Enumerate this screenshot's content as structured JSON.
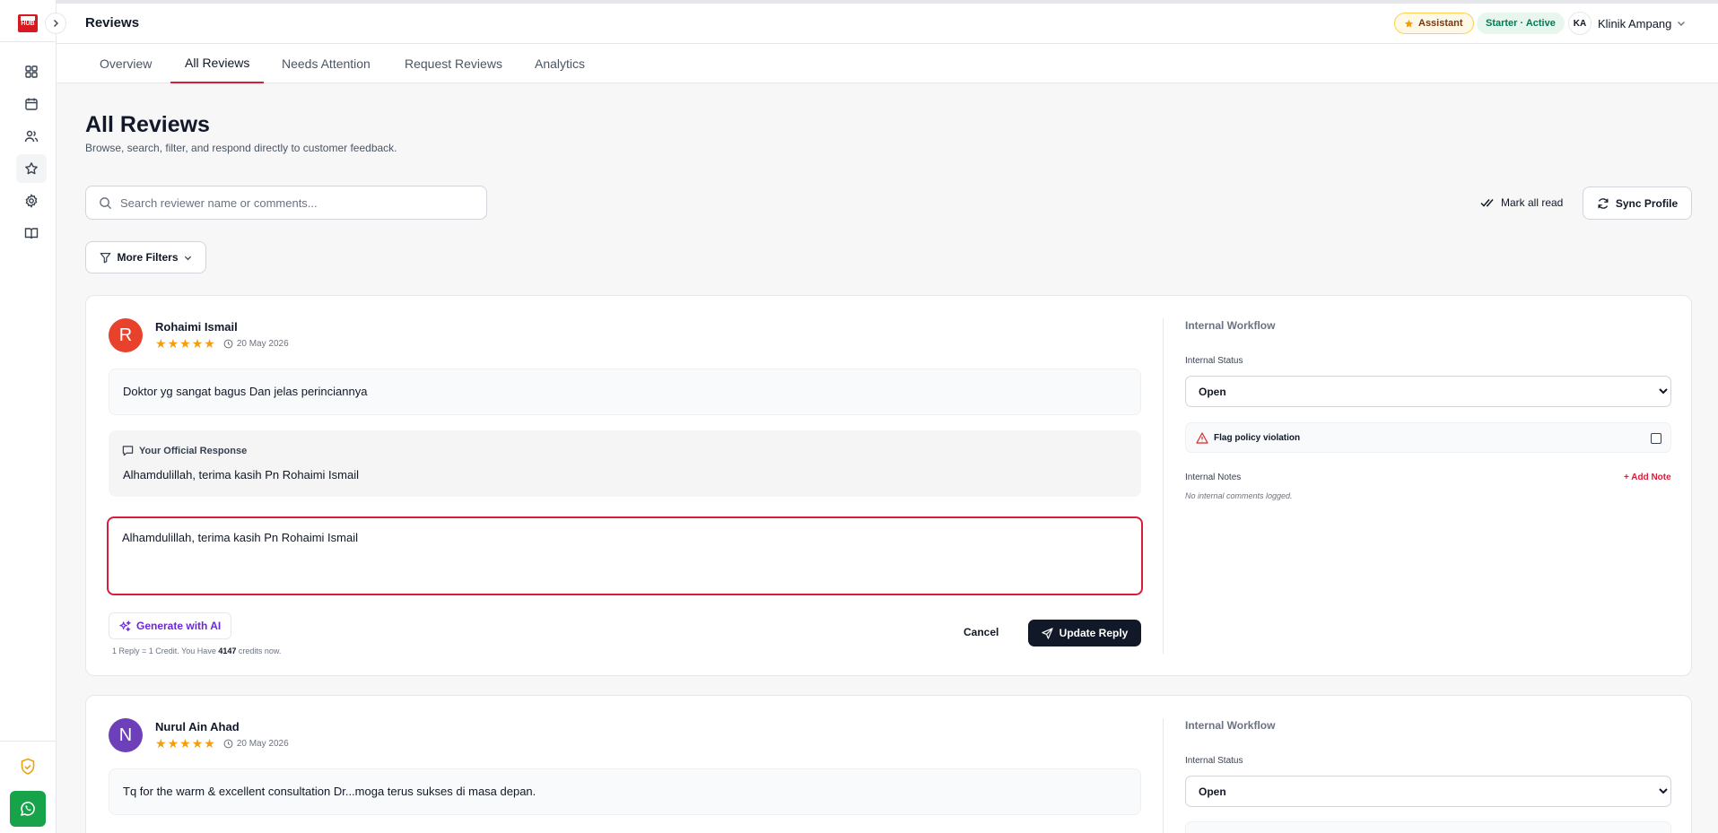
{
  "header": {
    "title": "Reviews",
    "assistant_label": "Assistant",
    "plan_label": "Starter · Active",
    "account_initials": "KA",
    "account_name": "Klinik Ampang"
  },
  "logo": {
    "text": "HUB"
  },
  "sidebar": {
    "items": [
      {
        "icon": "dashboard-icon"
      },
      {
        "icon": "calendar-icon"
      },
      {
        "icon": "users-icon"
      },
      {
        "icon": "star-icon",
        "active": true
      },
      {
        "icon": "gear-icon"
      },
      {
        "icon": "book-icon"
      }
    ],
    "bottom": [
      "shield-check-icon",
      "whatsapp-icon"
    ]
  },
  "tabs": [
    {
      "label": "Overview"
    },
    {
      "label": "All Reviews",
      "active": true
    },
    {
      "label": "Needs Attention"
    },
    {
      "label": "Request Reviews"
    },
    {
      "label": "Analytics"
    }
  ],
  "page": {
    "title": "All Reviews",
    "subtitle": "Browse, search, filter, and respond directly to customer feedback."
  },
  "search": {
    "placeholder": "Search reviewer name or comments...",
    "value": ""
  },
  "actions": {
    "mark_all_read": "Mark all read",
    "sync_profile": "Sync Profile",
    "more_filters": "More Filters"
  },
  "reviews": [
    {
      "initial": "R",
      "avatar_color": "#e8412c",
      "name": "Rohaimi Ismail",
      "rating": 5,
      "date": "20 May 2026",
      "comment": "Doktor yg sangat bagus Dan jelas perinciannya",
      "response_heading": "Your Official Response",
      "response": "Alhamdulillah, terima kasih Pn Rohaimi Ismail",
      "reply_draft": "Alhamdulillah, terima kasih Pn Rohaimi Ismail",
      "generate_ai": "Generate with AI",
      "credits_prefix": "1 Reply = 1 Credit. You Have",
      "credits": "4147",
      "credits_suffix": "credits now.",
      "cancel": "Cancel",
      "update": "Update Reply",
      "workflow": {
        "title": "Internal Workflow",
        "status_label": "Internal Status",
        "status": "Open",
        "flag_label": "Flag policy violation",
        "notes_label": "Internal Notes",
        "add_note": "+ Add Note",
        "no_notes": "No internal comments logged."
      }
    },
    {
      "initial": "N",
      "avatar_color": "#6d3fb8",
      "name": "Nurul Ain Ahad",
      "rating": 5,
      "date": "20 May 2026",
      "comment": "Tq for the warm & excellent consultation Dr...moga terus sukses di masa depan.",
      "workflow": {
        "title": "Internal Workflow",
        "status_label": "Internal Status",
        "status": "Open"
      }
    }
  ],
  "colors": {
    "accent": "#d61f3b",
    "primary_button": "#111827",
    "star": "#f59e0b",
    "whatsapp": "#16a34a"
  }
}
